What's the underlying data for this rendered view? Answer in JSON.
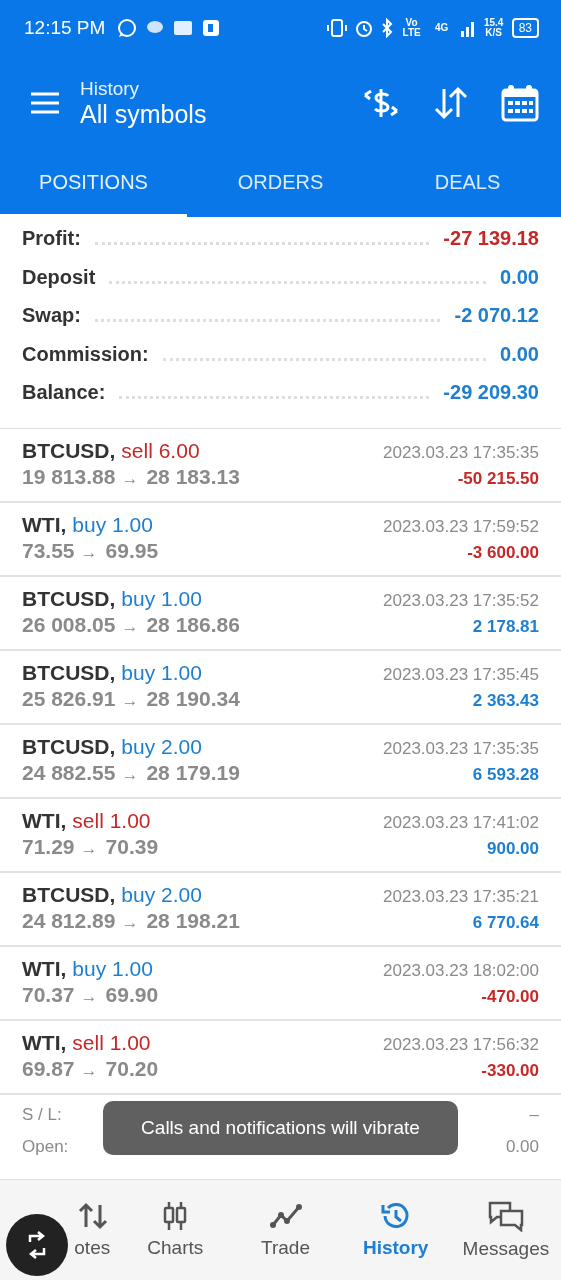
{
  "status_bar": {
    "time": "12:15 PM",
    "volte": "Vo LTE",
    "network": "4G",
    "speed": "15.4 K/S",
    "battery": "83"
  },
  "header": {
    "subtitle": "History",
    "title": "All symbols"
  },
  "tabs": [
    {
      "label": "POSITIONS",
      "selected": true
    },
    {
      "label": "ORDERS",
      "selected": false
    },
    {
      "label": "DEALS",
      "selected": false
    }
  ],
  "summary": [
    {
      "label": "Profit:",
      "value": "-27 139.18",
      "color": "#c62828"
    },
    {
      "label": "Deposit",
      "value": "0.00",
      "color": "#1e7fd0"
    },
    {
      "label": "Swap:",
      "value": "-2 070.12",
      "color": "#1e7fd0"
    },
    {
      "label": "Commission:",
      "value": "0.00",
      "color": "#1e7fd0"
    },
    {
      "label": "Balance:",
      "value": "-29 209.30",
      "color": "#1e7fd0"
    }
  ],
  "deals": [
    {
      "symbol": "BTCUSD,",
      "kind": "sell",
      "action": "sell 6.00",
      "open_price": "19 813.88",
      "arrow": "→",
      "close_price": "28 183.13",
      "time": "2023.03.23 17:35:35",
      "profit": "-50 215.50",
      "loss": true
    },
    {
      "symbol": "WTI,",
      "kind": "buy",
      "action": "buy 1.00",
      "open_price": "73.55",
      "arrow": "→",
      "close_price": "69.95",
      "time": "2023.03.23 17:59:52",
      "profit": "-3 600.00",
      "loss": true
    },
    {
      "symbol": "BTCUSD,",
      "kind": "buy",
      "action": "buy 1.00",
      "open_price": "26 008.05",
      "arrow": "→",
      "close_price": "28 186.86",
      "time": "2023.03.23 17:35:52",
      "profit": "2 178.81",
      "loss": false
    },
    {
      "symbol": "BTCUSD,",
      "kind": "buy",
      "action": "buy 1.00",
      "open_price": "25 826.91",
      "arrow": "→",
      "close_price": "28 190.34",
      "time": "2023.03.23 17:35:45",
      "profit": "2 363.43",
      "loss": false
    },
    {
      "symbol": "BTCUSD,",
      "kind": "buy",
      "action": "buy 2.00",
      "open_price": "24 882.55",
      "arrow": "→",
      "close_price": "28 179.19",
      "time": "2023.03.23 17:35:35",
      "profit": "6 593.28",
      "loss": false
    },
    {
      "symbol": "WTI,",
      "kind": "sell",
      "action": "sell 1.00",
      "open_price": "71.29",
      "arrow": "→",
      "close_price": "70.39",
      "time": "2023.03.23 17:41:02",
      "profit": "900.00",
      "loss": false
    },
    {
      "symbol": "BTCUSD,",
      "kind": "buy",
      "action": "buy 2.00",
      "open_price": "24 812.89",
      "arrow": "→",
      "close_price": "28 198.21",
      "time": "2023.03.23 17:35:21",
      "profit": "6 770.64",
      "loss": false
    },
    {
      "symbol": "WTI,",
      "kind": "buy",
      "action": "buy 1.00",
      "open_price": "70.37",
      "arrow": "→",
      "close_price": "69.90",
      "time": "2023.03.23 18:02:00",
      "profit": "-470.00",
      "loss": true
    },
    {
      "symbol": "WTI,",
      "kind": "sell",
      "action": "sell 1.00",
      "open_price": "69.87",
      "arrow": "→",
      "close_price": "70.20",
      "time": "2023.03.23 17:56:32",
      "profit": "-330.00",
      "loss": true
    }
  ],
  "details": {
    "sl_label": "S / L:",
    "tp_value": "–",
    "open_label": "Open:",
    "swap_value": "0.00"
  },
  "toast": "Calls and notifications will vibrate",
  "nav": [
    {
      "label": "otes",
      "selected": false
    },
    {
      "label": "Charts",
      "selected": false
    },
    {
      "label": "Trade",
      "selected": false
    },
    {
      "label": "History",
      "selected": true
    },
    {
      "label": "Messages",
      "selected": false
    }
  ]
}
